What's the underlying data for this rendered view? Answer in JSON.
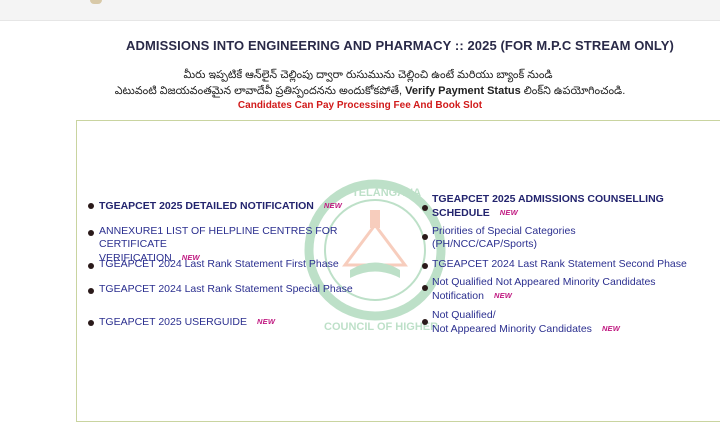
{
  "header": {
    "title": "ADMISSIONS INTO ENGINEERING AND PHARMACY :: 2025  (FOR M.P.C STREAM ONLY)",
    "telugu_line1": "మీరు ఇప్పటికే ఆన్‌లైన్ చెల్లింపు ద్వారా రుసుమును చెల్లించి ఉంటే మరియు బ్యాంక్ నుండి",
    "telugu_line2_pre": "ఎటువంటి విజయవంతమైన లావాదేవీ ప్రతిస్పందనను అందుకోకపోతే,",
    "telugu_line2_bold": "Verify Payment Status",
    "telugu_line2_post": "లింక్‌ని ఉపయోగించండి.",
    "notice": "Candidates Can Pay Processing Fee And Book Slot"
  },
  "new_badge": "NEW",
  "links_left": [
    {
      "label": "TGEAPCET 2025 DETAILED NOTIFICATION",
      "new": "NEW"
    },
    {
      "label_line1": "ANNEXURE1 LIST OF HELPLINE CENTRES FOR CERTIFICATE",
      "label_line2": "VERIFICATION",
      "new": "NEW"
    },
    {
      "label": "TGEAPCET 2024 Last Rank Statement First Phase"
    },
    {
      "label": "TGEAPCET 2024 Last Rank Statement Special Phase"
    },
    {
      "label": "TGEAPCET 2025 USERGUIDE",
      "new": "NEW"
    }
  ],
  "links_right": [
    {
      "label_line1": "TGEAPCET 2025 ADMISSIONS COUNSELLING",
      "label_line2": "SCHEDULE",
      "new": "NEW"
    },
    {
      "label_line1": "Priorities of Special Categories",
      "label_line2": "(PH/NCC/CAP/Sports)"
    },
    {
      "label": "TGEAPCET 2024 Last Rank Statement Second Phase"
    },
    {
      "label_line1": "Not Qualified Not Appeared Minority Candidates",
      "label_line2": "Notification",
      "new": "NEW"
    },
    {
      "label_line1": "Not Qualified/",
      "label_line2": "Not Appeared Minority Candidates",
      "new": "NEW"
    }
  ],
  "watermark": {
    "top_text": "TELANGANA",
    "side_text": "COUNCIL OF HIGHER",
    "color": "#3aa35a",
    "accent": "#e86a3a"
  }
}
